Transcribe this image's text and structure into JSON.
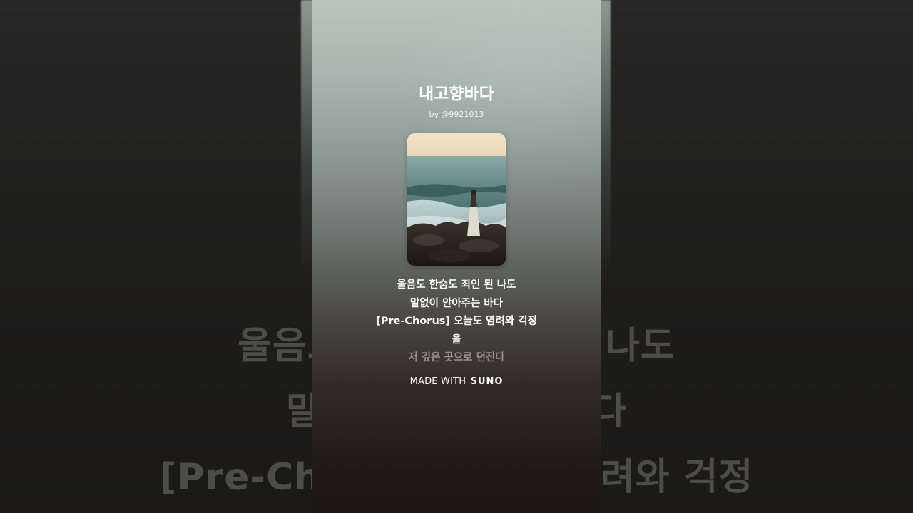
{
  "song": {
    "title": "내고향바다",
    "artist": "by @9921013"
  },
  "lyrics": {
    "lines": [
      "울음도 한숨도 죄인 된 나도",
      "말없이 안아주는 바다",
      "[Pre-Chorus] 오늘도 염려와 걱정",
      "을",
      "저 깊은 곳으로 던진다"
    ]
  },
  "background_lyrics": {
    "lines": [
      "울음도 한숨도 죄인 된 나도",
      "말없이 안아주는 바다",
      "[Pre-Chorus] 오늘도 염려와 걱정"
    ]
  },
  "footer": {
    "made_with": "MADE WITH",
    "brand": "SUNO"
  },
  "colors": {
    "text_primary": "#ffffff",
    "text_dim": "#9a8f88",
    "background": "#161616"
  },
  "icons": {
    "cover_art": "seaside-woman-cover-image"
  }
}
